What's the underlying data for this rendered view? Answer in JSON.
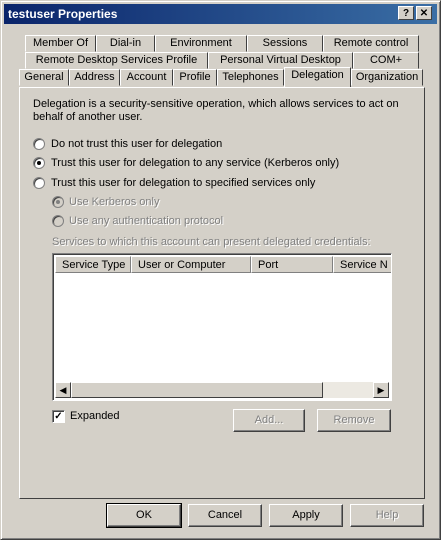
{
  "window": {
    "title": "testuser Properties",
    "help_glyph": "?",
    "close_glyph": "✕"
  },
  "tabs_row1": [
    {
      "label": "Member Of"
    },
    {
      "label": "Dial-in"
    },
    {
      "label": "Environment"
    },
    {
      "label": "Sessions"
    },
    {
      "label": "Remote control"
    }
  ],
  "tabs_row2": [
    {
      "label": "Remote Desktop Services Profile"
    },
    {
      "label": "Personal Virtual Desktop"
    },
    {
      "label": "COM+"
    }
  ],
  "tabs_row3": [
    {
      "label": "General"
    },
    {
      "label": "Address"
    },
    {
      "label": "Account"
    },
    {
      "label": "Profile"
    },
    {
      "label": "Telephones"
    },
    {
      "label": "Delegation"
    },
    {
      "label": "Organization"
    }
  ],
  "active_tab": "Delegation",
  "delegation": {
    "description_line1": "Delegation is a security-sensitive operation, which allows services to act on",
    "description_line2": "behalf of another user.",
    "options": [
      {
        "label": "Do not trust this user for delegation",
        "selected": false
      },
      {
        "label": "Trust this user for delegation to any service (Kerberos only)",
        "selected": true
      },
      {
        "label": "Trust this user for delegation to specified services only",
        "selected": false
      }
    ],
    "sub_options": [
      {
        "label": "Use Kerberos only",
        "selected": true
      },
      {
        "label": "Use any authentication protocol",
        "selected": false
      }
    ],
    "services_caption": "Services to which this account can present delegated credentials:",
    "columns": [
      "Service Type",
      "User or Computer",
      "Port",
      "Service N"
    ],
    "expanded_label": "Expanded",
    "expanded_checked": true,
    "expanded_check_glyph": "✓",
    "add_label": "Add...",
    "remove_label": "Remove",
    "scroll_left_glyph": "◀",
    "scroll_right_glyph": "▶"
  },
  "footer": {
    "ok": "OK",
    "cancel": "Cancel",
    "apply": "Apply",
    "help": "Help"
  }
}
